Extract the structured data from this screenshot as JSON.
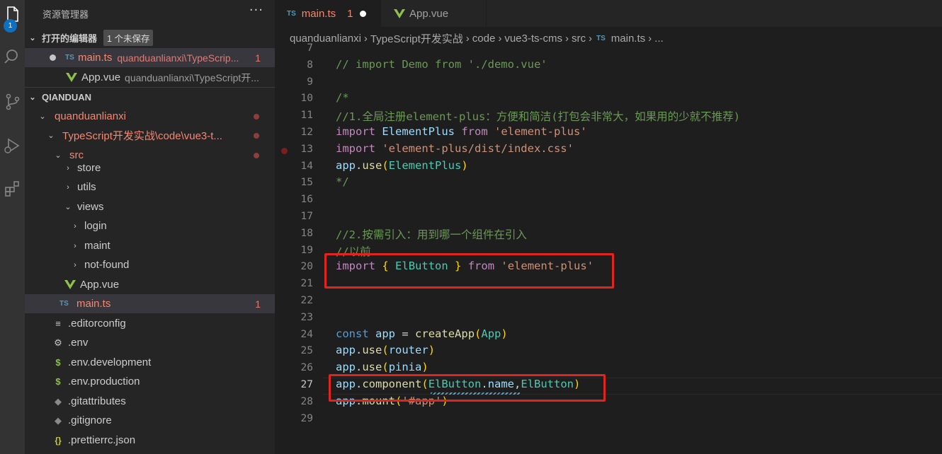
{
  "activity_bar": {
    "explorer_badge": "1",
    "icons": [
      "files-icon",
      "search-icon",
      "source-control-icon",
      "run-debug-icon",
      "extensions-icon"
    ]
  },
  "sidebar": {
    "title": "资源管理器",
    "more_actions": "···",
    "open_editors": {
      "header": "打开的编辑器",
      "unsaved_badge": "1 个未保存",
      "items": [
        {
          "icon": "TS",
          "name": "main.ts",
          "description": "quanduanlianxi\\TypeScrip...",
          "problems": "1"
        },
        {
          "icon": "vue",
          "name": "App.vue",
          "description": "quanduanlianxi\\TypeScript开..."
        }
      ]
    },
    "workspace": {
      "header": "QIANDUAN",
      "tree": [
        {
          "label": "quanduanlianxi"
        },
        {
          "label": "TypeScript开发实战\\code\\vue3-t..."
        },
        {
          "label": "src"
        },
        {
          "label": "store"
        },
        {
          "label": "utils"
        },
        {
          "label": "views"
        },
        {
          "label": "login"
        },
        {
          "label": "maint"
        },
        {
          "label": "not-found"
        },
        {
          "label": "App.vue"
        },
        {
          "label": "main.ts",
          "problems": "1"
        },
        {
          "label": ".editorconfig"
        },
        {
          "label": ".env"
        },
        {
          "label": ".env.development"
        },
        {
          "label": ".env.production"
        },
        {
          "label": ".gitattributes"
        },
        {
          "label": ".gitignore"
        },
        {
          "label": ".prettierrc.json"
        }
      ]
    }
  },
  "editor": {
    "tabs": [
      {
        "label": "main.ts",
        "icon": "TS",
        "problems": "1",
        "active": true,
        "dirty": true
      },
      {
        "label": "App.vue",
        "icon": "vue",
        "active": false
      }
    ],
    "breadcrumb": [
      "quanduanlianxi",
      "TypeScript开发实战",
      "code",
      "vue3-ts-cms",
      "src",
      "main.ts",
      "..."
    ],
    "breadcrumb_file_icon": "TS",
    "current_line": "27",
    "lines": [
      {
        "n": "7",
        "text": ""
      },
      {
        "n": "8",
        "text": "// import Demo from './demo.vue'"
      },
      {
        "n": "9",
        "text": ""
      },
      {
        "n": "10",
        "text": "/*"
      },
      {
        "n": "11",
        "text": "//1.全局注册element-plus：方便和简洁(打包会非常大，如果用的少就不推荐)"
      },
      {
        "n": "12",
        "text": "import ElementPlus from 'element-plus'"
      },
      {
        "n": "13",
        "text": "import 'element-plus/dist/index.css'"
      },
      {
        "n": "14",
        "text": "app.use(ElementPlus)"
      },
      {
        "n": "15",
        "text": "*/"
      },
      {
        "n": "16",
        "text": ""
      },
      {
        "n": "17",
        "text": ""
      },
      {
        "n": "18",
        "text": "//2.按需引入：用到哪一个组件在引入"
      },
      {
        "n": "19",
        "text": "//以前"
      },
      {
        "n": "20",
        "text": "import { ElButton } from 'element-plus'"
      },
      {
        "n": "21",
        "text": ""
      },
      {
        "n": "22",
        "text": ""
      },
      {
        "n": "23",
        "text": ""
      },
      {
        "n": "24",
        "text": "const app = createApp(App)"
      },
      {
        "n": "25",
        "text": "app.use(router)"
      },
      {
        "n": "26",
        "text": "app.use(pinia)"
      },
      {
        "n": "27",
        "text": "app.component(ElButton.name,ElButton)"
      },
      {
        "n": "28",
        "text": "app.mount('#app')"
      },
      {
        "n": "29",
        "text": ""
      }
    ]
  },
  "colors": {
    "accent_badge": "#0e70c0",
    "highlight_box": "#e0241f",
    "error_text": "#f48771",
    "comment": "#6a9955",
    "keyword": "#c586c0"
  }
}
